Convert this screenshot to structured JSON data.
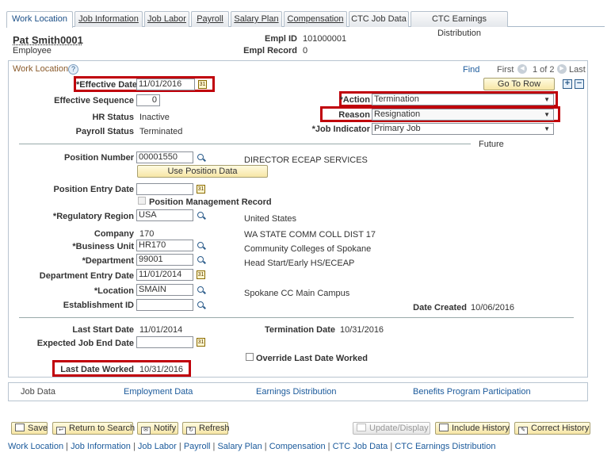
{
  "tabs": [
    {
      "label": "Work Location",
      "active": true
    },
    {
      "label": "Job Information",
      "active": false
    },
    {
      "label": "Job Labor",
      "active": false
    },
    {
      "label": "Payroll",
      "active": false
    },
    {
      "label": "Salary Plan",
      "active": false
    },
    {
      "label": "Compensation",
      "active": false
    },
    {
      "label": "CTC Job Data",
      "active": false
    },
    {
      "label": "CTC Earnings Distribution",
      "active": false
    }
  ],
  "header": {
    "name": "Pat Smith0001",
    "role": "Employee",
    "empl_id_label": "Empl ID",
    "empl_id": "101000001",
    "empl_record_label": "Empl Record",
    "empl_record": "0"
  },
  "section": {
    "title": "Work Location",
    "help": "?",
    "find": "Find",
    "first": "First",
    "pager": "1 of 2",
    "last": "Last",
    "go_to_row": "Go To Row",
    "add": "+",
    "remove": "−"
  },
  "fields": {
    "effective_date_label": "*Effective Date",
    "effective_date": "11/01/2016",
    "effective_sequence_label": "Effective Sequence",
    "effective_sequence": "0",
    "hr_status_label": "HR Status",
    "hr_status": "Inactive",
    "payroll_status_label": "Payroll Status",
    "payroll_status": "Terminated",
    "action_label": "*Action",
    "action": "Termination",
    "reason_label": "Reason",
    "reason": "Resignation",
    "job_indicator_label": "*Job Indicator",
    "job_indicator": "Primary Job",
    "future": "Future",
    "position_number_label": "Position Number",
    "position_number": "00001550",
    "position_desc": "DIRECTOR ECEAP SERVICES",
    "use_position_data": "Use Position Data",
    "position_entry_date_label": "Position Entry Date",
    "position_entry_date": "",
    "position_management_record": "Position Management Record",
    "regulatory_region_label": "*Regulatory Region",
    "regulatory_region": "USA",
    "regulatory_region_desc": "United States",
    "company_label": "Company",
    "company": "170",
    "company_desc": "WA STATE COMM COLL DIST 17",
    "business_unit_label": "*Business Unit",
    "business_unit": "HR170",
    "business_unit_desc": "Community Colleges of Spokane",
    "department_label": "*Department",
    "department": "99001",
    "department_desc": "Head Start/Early HS/ECEAP",
    "department_entry_date_label": "Department Entry Date",
    "department_entry_date": "11/01/2014",
    "location_label": "*Location",
    "location": "SMAIN",
    "location_desc": "Spokane CC Main Campus",
    "establishment_id_label": "Establishment ID",
    "establishment_id": "",
    "date_created_label": "Date Created",
    "date_created": "10/06/2016",
    "last_start_date_label": "Last Start Date",
    "last_start_date": "11/01/2014",
    "termination_date_label": "Termination Date",
    "termination_date": "10/31/2016",
    "expected_job_end_date_label": "Expected Job End Date",
    "expected_job_end_date": "",
    "override_last_date_worked": "Override Last Date Worked",
    "last_date_worked_label": "Last Date Worked",
    "last_date_worked": "10/31/2016"
  },
  "subnav": {
    "job_data": "Job Data",
    "employment_data": "Employment Data",
    "earnings_distribution": "Earnings Distribution",
    "benefits_program_participation": "Benefits Program Participation"
  },
  "toolbar": {
    "save": "Save",
    "return_to_search": "Return to Search",
    "notify": "Notify",
    "refresh": "Refresh",
    "update_display": "Update/Display",
    "include_history": "Include History",
    "correct_history": "Correct History"
  },
  "footer_links": [
    "Work Location",
    "Job Information",
    "Job Labor",
    "Payroll",
    "Salary Plan",
    "Compensation",
    "CTC Job Data",
    "CTC Earnings Distribution"
  ],
  "colors": {
    "highlight": "#c0000a",
    "link": "#1b5a9b",
    "button_gold": "#f7e6a6"
  }
}
